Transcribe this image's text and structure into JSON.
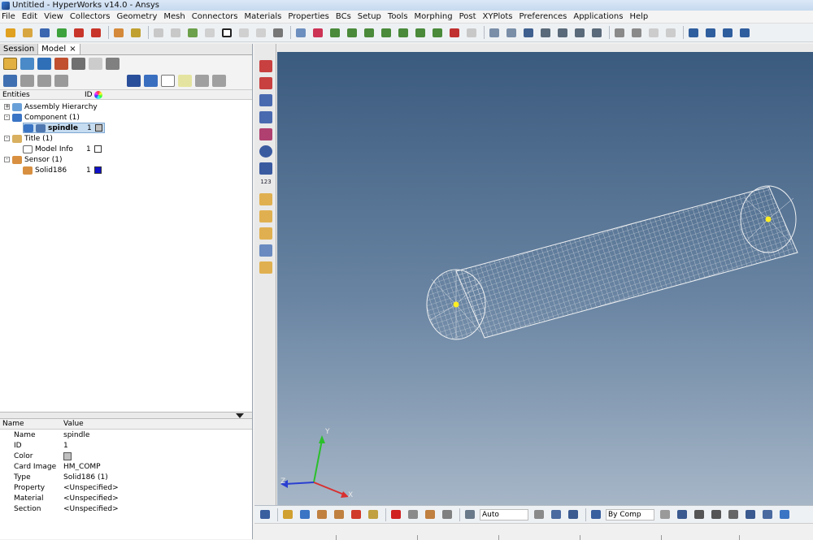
{
  "window": {
    "title": "Untitled - HyperWorks v14.0 - Ansys"
  },
  "menu": [
    "File",
    "Edit",
    "View",
    "Collectors",
    "Geometry",
    "Mesh",
    "Connectors",
    "Materials",
    "Properties",
    "BCs",
    "Setup",
    "Tools",
    "Morphing",
    "Post",
    "XYPlots",
    "Preferences",
    "Applications",
    "Help"
  ],
  "tabs": {
    "session": "Session",
    "model": "Model",
    "close": "×"
  },
  "browser": {
    "col_entities": "Entities",
    "col_id": "ID",
    "rows": {
      "assembly": "Assembly Hierarchy",
      "component": "Component (1)",
      "spindle": "spindle",
      "spindle_id": "1",
      "title": "Title (1)",
      "model_info": "Model Info",
      "model_info_id": "1",
      "sensor": "Sensor (1)",
      "solid186": "Solid186",
      "solid186_id": "1"
    },
    "expand_plus": "+",
    "expand_minus": "-"
  },
  "props": {
    "col_name": "Name",
    "col_value": "Value",
    "rows": [
      {
        "name": "Name",
        "value": "spindle"
      },
      {
        "name": "ID",
        "value": "1"
      },
      {
        "name": "Color",
        "value": ""
      },
      {
        "name": "Card Image",
        "value": "HM_COMP"
      },
      {
        "name": "Type",
        "value": "Solid186 (1)"
      },
      {
        "name": "Property",
        "value": "<Unspecified>"
      },
      {
        "name": "Material",
        "value": "<Unspecified>"
      },
      {
        "name": "Section",
        "value": "<Unspecified>"
      }
    ]
  },
  "vtool_label": "123",
  "bottom": {
    "auto": "Auto",
    "bycomp": "By Comp"
  },
  "triad": {
    "x": "X",
    "y": "Y",
    "z": "Z"
  },
  "colors": {
    "solid186": "#1010c8",
    "spindle": "#c0c0c0",
    "model_info": "#ffffff",
    "highlight": "#c6dcf0"
  }
}
